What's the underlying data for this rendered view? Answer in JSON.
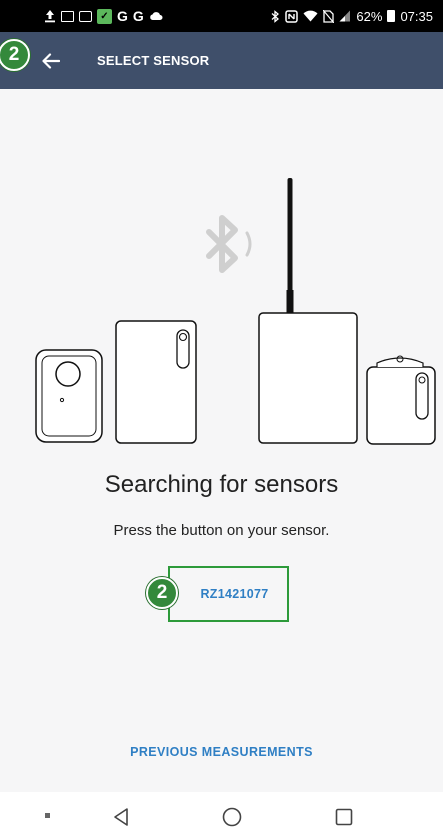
{
  "status_bar": {
    "battery_percent": "62%",
    "time": "07:35",
    "left_icons": [
      "upload-icon",
      "image-icon",
      "message-icon",
      "app-icon",
      "google-icon",
      "google-icon",
      "cloud-icon"
    ],
    "right_icons": [
      "bluetooth-icon",
      "nfc-icon",
      "wifi-icon",
      "no-sim-icon",
      "signal-icon",
      "battery-icon"
    ]
  },
  "app_bar": {
    "title": "SELECT SENSOR",
    "back_icon": "arrow-left-icon",
    "step_badge": "2",
    "background": "#3f4f6a"
  },
  "illustration": {
    "bluetooth_icon": "bluetooth-searching-icon"
  },
  "main": {
    "title": "Searching for sensors",
    "subtitle": "Press the button on your sensor."
  },
  "sensor": {
    "id": "RZ1421077",
    "step_badge": "2",
    "border_color": "#2d9a3a",
    "text_color": "#2f7fc4"
  },
  "footer": {
    "previous_label": "PREVIOUS MEASUREMENTS"
  },
  "nav_bar": {
    "buttons": [
      "back-icon",
      "home-icon",
      "recents-icon"
    ]
  }
}
